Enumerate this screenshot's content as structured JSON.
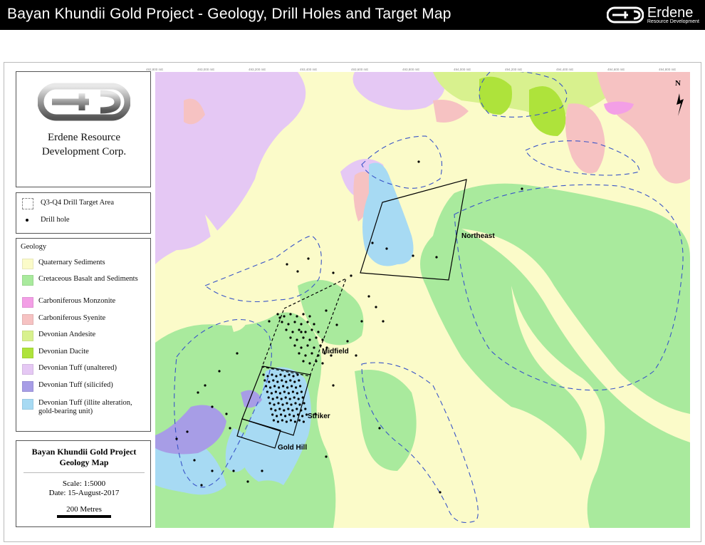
{
  "header": {
    "title": "Bayan Khundii Gold Project - Geology, Drill Holes and Target Map",
    "brand_name": "Erdene",
    "brand_sub": "Resource Development"
  },
  "company": {
    "line1": "Erdene Resource",
    "line2": "Development Corp."
  },
  "legend_top": {
    "target_label": "Q3-Q4 Drill Target Area",
    "drillhole_label": "Drill hole"
  },
  "geology": {
    "heading": "Geology",
    "items": [
      {
        "label": "Quaternary Sediments",
        "color": "#fbfbc9"
      },
      {
        "label": "Cretaceous Basalt and Sediments",
        "color": "#a9ea9d"
      },
      {
        "label": "Carboniferous Monzonite",
        "color": "#f39fe6"
      },
      {
        "label": "Carboniferous Syenite",
        "color": "#f6c2c2"
      },
      {
        "label": "Devonian Andesite",
        "color": "#d8f18e"
      },
      {
        "label": "Devonian Dacite",
        "color": "#aee33b"
      },
      {
        "label": "Devonian Tuff (unaltered)",
        "color": "#e5c8f4"
      },
      {
        "label": "Devonian Tuff (silicifed)",
        "color": "#a79de6"
      },
      {
        "label": "Devonian Tuff (illite alteration, gold-bearing unit)",
        "color": "#a7daf3"
      }
    ]
  },
  "titlebox": {
    "title1": "Bayan Khundii Gold Project",
    "title2": "Geology Map",
    "scale": "Scale: 1:5000",
    "date": "Date: 15-August-2017",
    "scalebar": "200 Metres"
  },
  "map": {
    "labels": {
      "northeast": "Northeast",
      "midfield": "Midfield",
      "striker": "Striker",
      "goldhill": "Gold Hill",
      "north": "N"
    },
    "tick_top": [
      "492,800 mE",
      "493,000 mE",
      "493,200 mE",
      "493,400 mE",
      "493,600 mE",
      "493,800 mE",
      "494,000 mE",
      "494,200 mE",
      "494,400 mE",
      "494,600 mE",
      "494,800 mE"
    ],
    "colors": {
      "quaternary": "#fbfbc9",
      "basalt": "#a9ea9d",
      "monzonite": "#f39fe6",
      "syenite": "#f6c2c2",
      "andesite": "#d8f18e",
      "dacite": "#aee33b",
      "tuff": "#e5c8f4",
      "silicified": "#a79de6",
      "illite": "#a7daf3",
      "target_line": "#3a55c8"
    }
  }
}
